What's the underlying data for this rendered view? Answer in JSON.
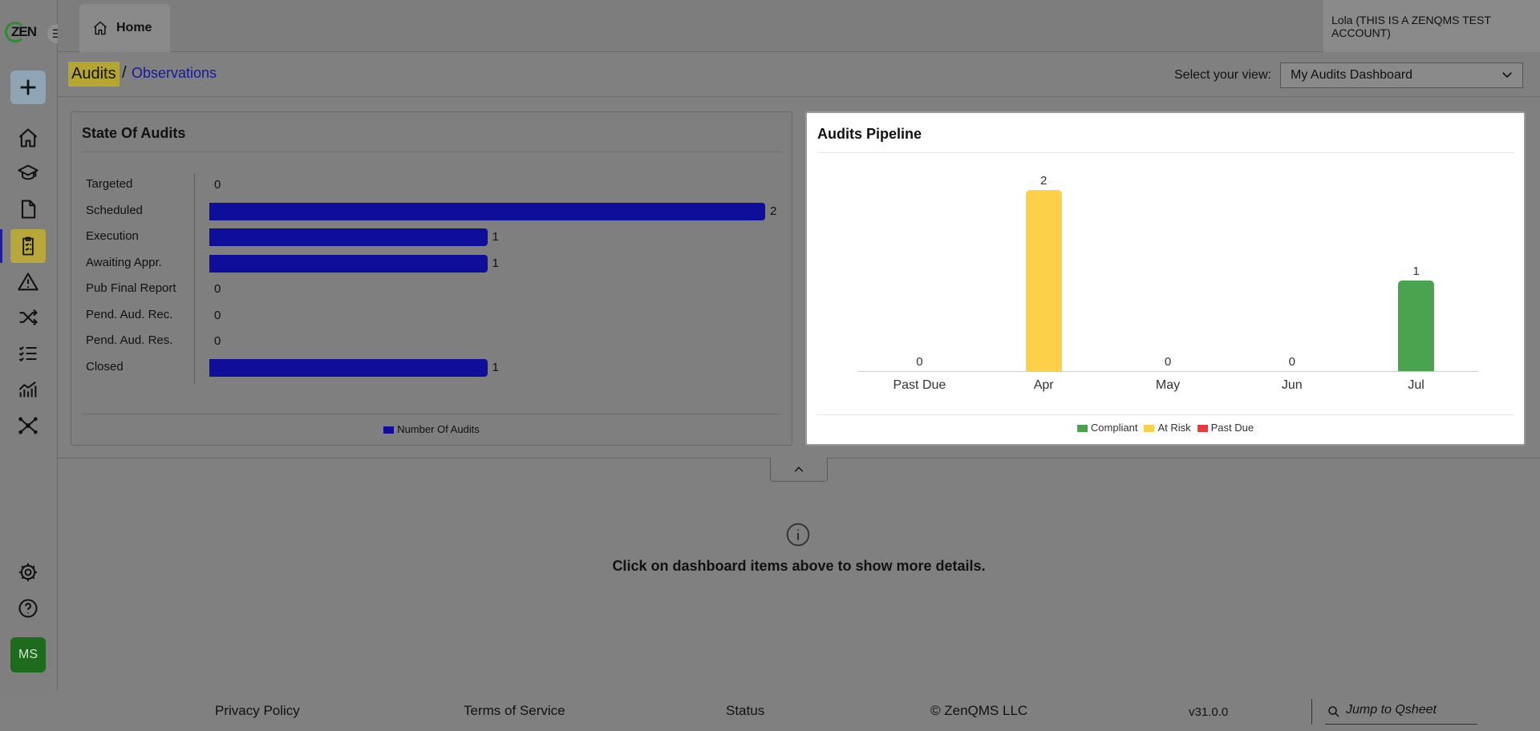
{
  "app": {
    "logo_text": "ZEN",
    "menu_glyph": "☰"
  },
  "topbar": {
    "home_tab_label": "Home",
    "user_label": "Lola (THIS IS A ZENQMS TEST ACCOUNT)"
  },
  "sidebar": {
    "items": [
      {
        "icon": "plus-icon"
      },
      {
        "icon": "home-icon"
      },
      {
        "icon": "graduation-cap-icon"
      },
      {
        "icon": "document-icon"
      },
      {
        "icon": "clipboard-check-icon",
        "active": true
      },
      {
        "icon": "warning-icon"
      },
      {
        "icon": "shuffle-icon"
      },
      {
        "icon": "checklist-icon"
      },
      {
        "icon": "analytics-icon"
      },
      {
        "icon": "network-icon"
      },
      {
        "icon": "settings-icon"
      },
      {
        "icon": "help-icon"
      }
    ],
    "avatar_initials": "MS"
  },
  "breadcrumb": {
    "current": "Audits",
    "separator": "/",
    "link": "Observations"
  },
  "view_selector": {
    "label": "Select your view:",
    "selected": "My Audits Dashboard"
  },
  "state_of_audits": {
    "title": "State Of Audits",
    "legend": "Number Of Audits",
    "bar_color": "#0e0e9a"
  },
  "audits_pipeline": {
    "title": "Audits Pipeline",
    "legend": [
      {
        "label": "Compliant",
        "color": "#49a34f"
      },
      {
        "label": "At Risk",
        "color": "#fdd04a"
      },
      {
        "label": "Past Due",
        "color": "#e83a3a"
      }
    ]
  },
  "chart_data": [
    {
      "type": "bar",
      "orientation": "horizontal",
      "title": "State Of Audits",
      "categories": [
        "Targeted",
        "Scheduled",
        "Execution",
        "Awaiting Appr.",
        "Pub Final Report",
        "Pend. Aud. Rec.",
        "Pend. Aud. Res.",
        "Closed"
      ],
      "series": [
        {
          "name": "Number Of Audits",
          "values": [
            0,
            2,
            1,
            1,
            0,
            0,
            0,
            1
          ]
        }
      ],
      "xlim": [
        0,
        2
      ],
      "legend": "bottom-center",
      "grid": false
    },
    {
      "type": "bar",
      "orientation": "vertical",
      "title": "Audits Pipeline",
      "categories": [
        "Past Due",
        "Apr",
        "May",
        "Jun",
        "Jul"
      ],
      "values": [
        0,
        2,
        0,
        0,
        1
      ],
      "bar_colors": [
        "#e83a3a",
        "#fdd04a",
        "#49a34f",
        "#49a34f",
        "#49a34f"
      ],
      "series_legend": [
        "Compliant",
        "At Risk",
        "Past Due"
      ],
      "ylim": [
        0,
        2
      ],
      "legend": "bottom-center",
      "grid": false
    }
  ],
  "details": {
    "message": "Click on dashboard items above to show more details."
  },
  "footer": {
    "privacy": "Privacy Policy",
    "terms": "Terms of Service",
    "status": "Status",
    "copyright": "© ZenQMS LLC",
    "version": "v31.0.0",
    "jump_placeholder": "Jump to Qsheet"
  }
}
